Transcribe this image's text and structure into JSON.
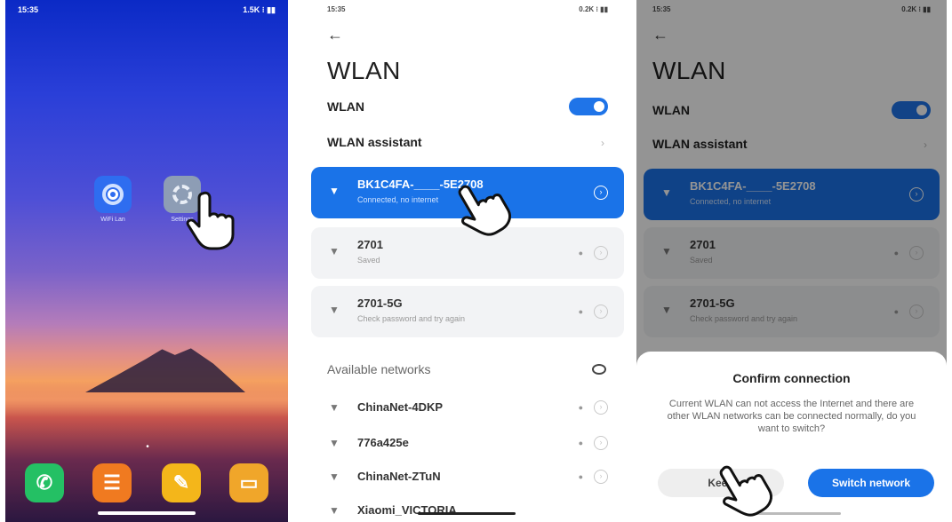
{
  "home_screen": {
    "status_time": "15:35",
    "status_right": "1.5K ⁝ ▮▮",
    "apps": [
      {
        "label": "WiFi Lan",
        "icon": "wifi-lan-icon"
      },
      {
        "label": "Settings",
        "icon": "settings-gear-icon"
      }
    ],
    "dock": [
      {
        "icon": "phone-icon",
        "glyph": "✆"
      },
      {
        "icon": "file-manager-icon",
        "glyph": "☰"
      },
      {
        "icon": "notes-icon",
        "glyph": "✎"
      },
      {
        "icon": "messages-icon",
        "glyph": "▭"
      }
    ],
    "page_indicator": "•"
  },
  "wlan_screen": {
    "status_time": "15:35",
    "status_right": "0.2K ⁝ ▮▮",
    "back_glyph": "←",
    "title": "WLAN",
    "wlan_toggle_label": "WLAN",
    "wlan_enabled": true,
    "assistant_label": "WLAN assistant",
    "saved_networks": [
      {
        "name": "BK1C4FA-____-5E2708",
        "sub": "Connected, no internet",
        "active": true
      },
      {
        "name": "2701",
        "sub": "Saved",
        "active": false
      },
      {
        "name": "2701-5G",
        "sub": "Check password and try again",
        "active": false
      }
    ],
    "available_label": "Available networks",
    "available_networks": [
      "ChinaNet-4DKP",
      "776a425e",
      "ChinaNet-ZTuN",
      "Xiaomi_VICTORIA"
    ]
  },
  "confirm_dialog": {
    "title": "Confirm connection",
    "body": "Current WLAN can not access the Internet and there are other WLAN networks can be connected normally, do you want to switch?",
    "keep_label": "Keep",
    "switch_label": "Switch network"
  },
  "colors": {
    "accent": "#1a73e8",
    "active_card": "#1a73e8"
  }
}
